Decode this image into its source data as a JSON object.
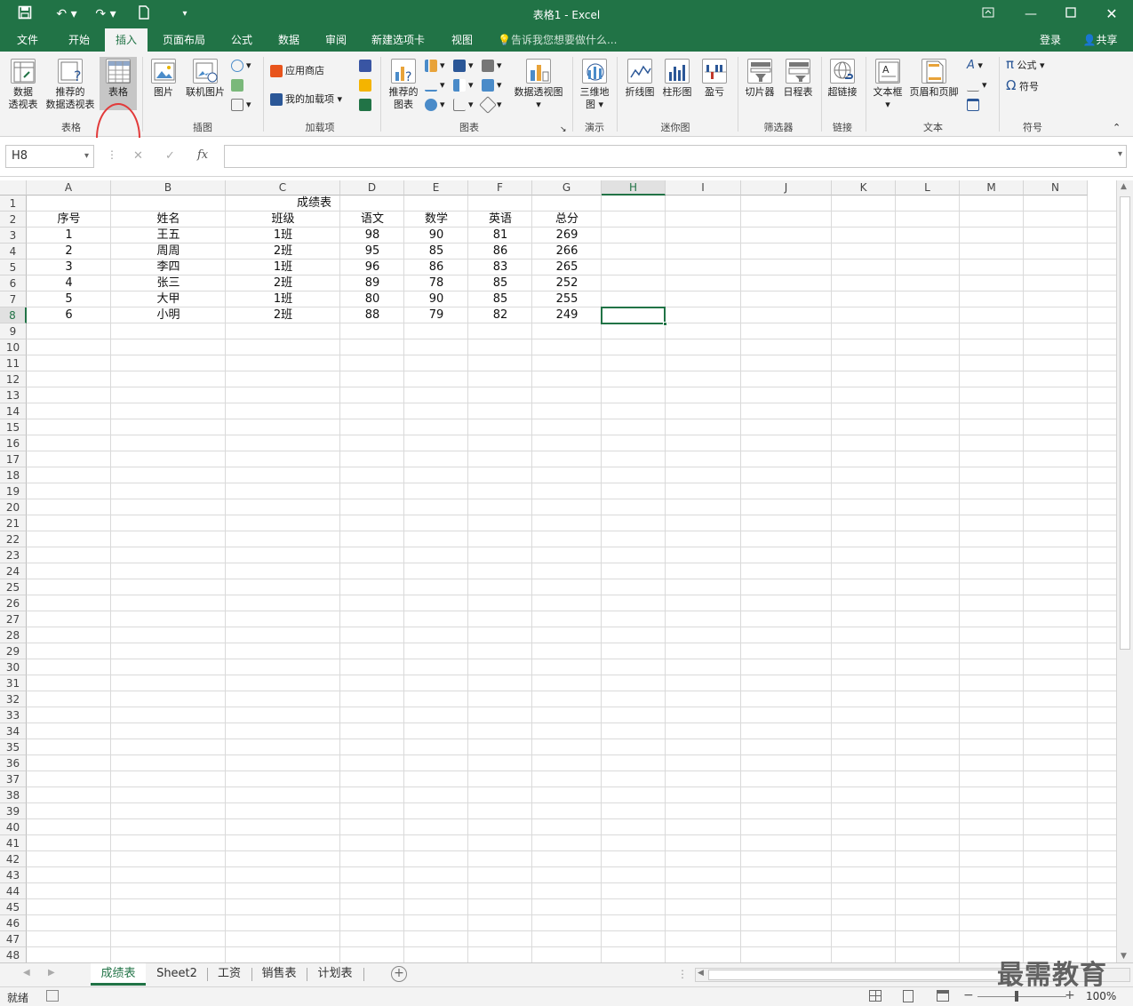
{
  "window": {
    "title": "表格1 - Excel",
    "accent": "#217346"
  },
  "quick_access": {
    "save_icon": "save-icon",
    "undo_icon": "undo-icon",
    "redo_icon": "redo-icon",
    "new_icon": "new-file-icon"
  },
  "tabs": [
    "文件",
    "开始",
    "插入",
    "页面布局",
    "公式",
    "数据",
    "审阅",
    "新建选项卡",
    "视图"
  ],
  "active_tab": "插入",
  "tell_me": "告诉我您想要做什么...",
  "account": {
    "login": "登录",
    "share": "共享"
  },
  "ribbon": {
    "pivot_table": "数据\n透视表",
    "pivot_table_l1": "数据",
    "pivot_table_l2": "透视表",
    "rec_pivot_l1": "推荐的",
    "rec_pivot_l2": "数据透视表",
    "table": "表格",
    "picture": "图片",
    "online_picture": "联机图片",
    "store": "应用商店",
    "my_addins": "我的加载项",
    "rec_charts_l1": "推荐的",
    "rec_charts_l2": "图表",
    "pivot_chart": "数据透视图",
    "map3d_l1": "三维地",
    "map3d_l2": "图",
    "line": "折线图",
    "column": "柱形图",
    "winloss": "盈亏",
    "slicer": "切片器",
    "timeline": "日程表",
    "hyperlink": "超链接",
    "textbox": "文本框",
    "header_footer": "页眉和页脚",
    "equation": "公式",
    "symbol": "符号",
    "groups": {
      "tables": "表格",
      "illustrations": "插图",
      "addins": "加载项",
      "charts": "图表",
      "tours": "演示",
      "sparklines": "迷你图",
      "filters": "筛选器",
      "links": "链接",
      "text": "文本",
      "symbols": "符号"
    }
  },
  "formula_bar": {
    "name_box": "H8",
    "fx": "fx",
    "cancel": "✕",
    "enter": "✓",
    "content": ""
  },
  "columns": [
    "A",
    "B",
    "C",
    "D",
    "E",
    "F",
    "G",
    "H",
    "I",
    "J",
    "K",
    "L",
    "M",
    "N"
  ],
  "selected_column": "H",
  "selected_row": 8,
  "selected_cell": "H8",
  "row_count": 48,
  "sheet": {
    "title": "成绩表",
    "headers": [
      "序号",
      "姓名",
      "班级",
      "语文",
      "数学",
      "英语",
      "总分"
    ],
    "rows": [
      [
        "1",
        "王五",
        "1班",
        "98",
        "90",
        "81",
        "269"
      ],
      [
        "2",
        "周周",
        "2班",
        "95",
        "85",
        "86",
        "266"
      ],
      [
        "3",
        "李四",
        "1班",
        "96",
        "86",
        "83",
        "265"
      ],
      [
        "4",
        "张三",
        "2班",
        "89",
        "78",
        "85",
        "252"
      ],
      [
        "5",
        "大甲",
        "1班",
        "80",
        "90",
        "85",
        "255"
      ],
      [
        "6",
        "小明",
        "2班",
        "88",
        "79",
        "82",
        "249"
      ]
    ]
  },
  "sheet_tabs": [
    "成绩表",
    "Sheet2",
    "工资",
    "销售表",
    "计划表"
  ],
  "active_sheet": "成绩表",
  "status": {
    "ready": "就绪",
    "zoom": "100%"
  },
  "watermark": "最需教育"
}
